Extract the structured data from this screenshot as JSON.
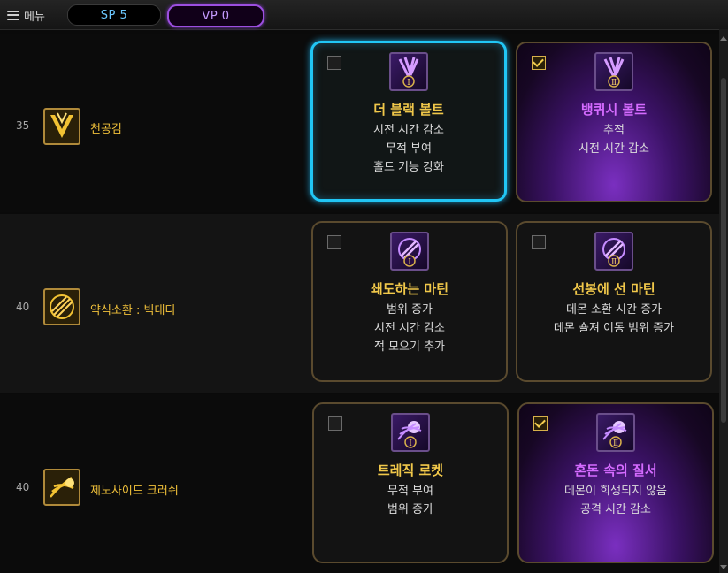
{
  "topbar": {
    "menu_label": "메뉴",
    "sp_label": "SP 5",
    "vp_label": "VP 0"
  },
  "rows": [
    {
      "level": "35",
      "skill_name": "천공검",
      "skill_icon": "thunder-blades-icon",
      "cards": [
        {
          "checked": false,
          "state": "selected-blue",
          "icon": "purple-blades-roman-1-icon",
          "title": "더 블랙 볼트",
          "lines": [
            "시전 시간 감소",
            "무적 부여",
            "홀드 기능 강화"
          ]
        },
        {
          "checked": true,
          "state": "active-purple",
          "icon": "purple-blades-roman-2-icon",
          "title": "뱅퀴시 볼트",
          "lines": [
            "추적",
            "시전 시간 감소",
            ""
          ]
        }
      ]
    },
    {
      "level": "40",
      "skill_name": "약식소환 : 빅대디",
      "skill_icon": "summon-daddy-icon",
      "cards": [
        {
          "checked": false,
          "state": "normal",
          "icon": "purple-martin-roman-1-icon",
          "title": "쇄도하는 마틴",
          "lines": [
            "범위 증가",
            "시전 시간 감소",
            "적 모으기 추가"
          ]
        },
        {
          "checked": false,
          "state": "normal",
          "icon": "purple-martin-roman-2-icon",
          "title": "선봉에 선 마틴",
          "lines": [
            "데몬 소환 시간 증가",
            "데몬 숄져 이동 범위 증가",
            ""
          ]
        }
      ]
    },
    {
      "level": "40",
      "skill_name": "제노사이드 크러쉬",
      "skill_icon": "genocide-crush-icon",
      "cards": [
        {
          "checked": false,
          "state": "normal",
          "icon": "purple-crush-roman-1-icon",
          "title": "트레직 로켓",
          "lines": [
            "무적 부여",
            "범위 증가",
            ""
          ]
        },
        {
          "checked": true,
          "state": "active-purple",
          "icon": "purple-crush-roman-2-icon",
          "title": "혼돈 속의 질서",
          "lines": [
            "데몬이 희생되지 않음",
            "공격 시간 감소",
            ""
          ]
        }
      ]
    }
  ]
}
